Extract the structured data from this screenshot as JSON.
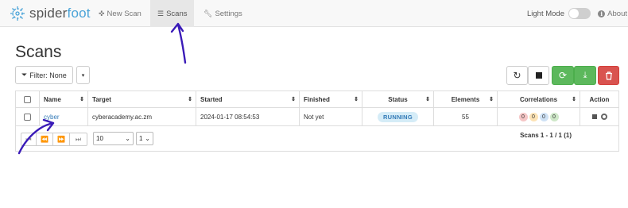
{
  "navbar": {
    "brand_part1": "spider",
    "brand_part2": "foot",
    "new_scan": "New Scan",
    "scans": "Scans",
    "settings": "Settings",
    "light_mode": "Light Mode",
    "about": "About",
    "light_mode_enabled": false
  },
  "page": {
    "title": "Scans"
  },
  "filter": {
    "label": "Filter: None"
  },
  "table": {
    "headers": {
      "name": "Name",
      "target": "Target",
      "started": "Started",
      "finished": "Finished",
      "status": "Status",
      "elements": "Elements",
      "correlations": "Correlations",
      "action": "Action"
    },
    "rows": [
      {
        "name": "cyber",
        "target": "cyberacademy.ac.zm",
        "started": "2024-01-17 08:54:53",
        "finished": "Not yet",
        "status": "RUNNING",
        "elements": "55",
        "correlations": {
          "high": "0",
          "medium": "0",
          "low": "0",
          "info": "0"
        }
      }
    ]
  },
  "pagination": {
    "page_size": "10",
    "page_number": "1",
    "summary": "Scans 1 - 1 / 1 (1)"
  },
  "colors": {
    "brand_blue": "#4aa3d8",
    "success": "#5cb85c",
    "danger": "#d9534f",
    "annotation": "#3a1bb8"
  }
}
